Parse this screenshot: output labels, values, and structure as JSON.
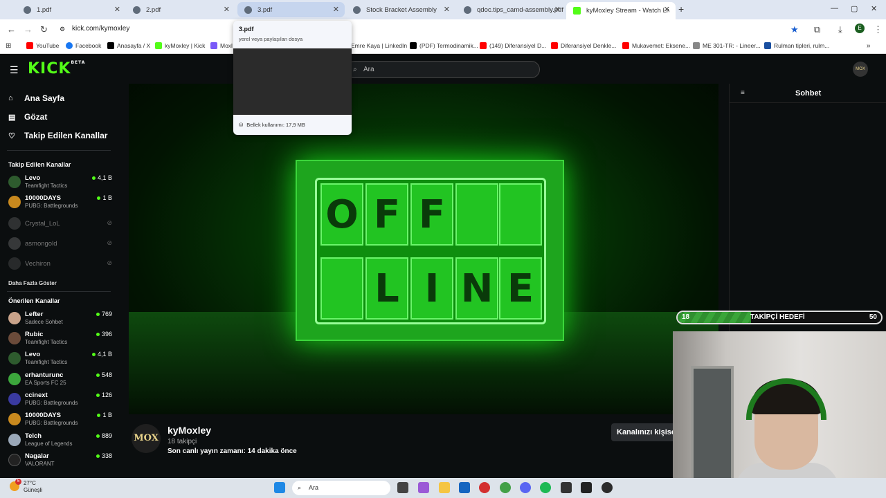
{
  "browser": {
    "tabs": [
      {
        "label": "1.pdf",
        "color": "#5f6b7a"
      },
      {
        "label": "2.pdf",
        "color": "#5f6b7a"
      },
      {
        "label": "3.pdf",
        "color": "#5f6b7a"
      },
      {
        "label": "Stock Bracket Assembly",
        "color": "#5f6b7a"
      },
      {
        "label": "qdoc.tips_camd-assembly.pdf",
        "color": "#5f6b7a"
      },
      {
        "label": "kyMoxley Stream - Watch Live o",
        "color": "#53fc18"
      }
    ],
    "url": "kick.com/kymoxley",
    "bookmarks": [
      {
        "label": "YouTube",
        "color": "#ff0000"
      },
      {
        "label": "Facebook",
        "color": "#1877f2"
      },
      {
        "label": "Anasayfa / X",
        "color": "#000000"
      },
      {
        "label": "kyMoxley | Kick",
        "color": "#53fc18"
      },
      {
        "label": "Moxl",
        "color": "#7a5af8"
      },
      {
        "label": "Emre Kaya | LinkedIn",
        "color": "#ffffff"
      },
      {
        "label": "(PDF) Termodinamik...",
        "color": "#000000"
      },
      {
        "label": "(149) Diferansiyel D...",
        "color": "#ff0000"
      },
      {
        "label": "Diferansiyel Denkle...",
        "color": "#ff0000"
      },
      {
        "label": "Mukavemet: Eksene...",
        "color": "#ff0000"
      },
      {
        "label": "ME 301-TR: - Lineer...",
        "color": "#888888"
      },
      {
        "label": "Rulman tipleri, rulm...",
        "color": "#1a4fa0"
      }
    ]
  },
  "hovercard": {
    "title": "3.pdf",
    "subtitle": "yerel veya paylaşılan dosya",
    "memory": "Bellek kullanımı: 17,9 MB"
  },
  "kick": {
    "logo": "KICK",
    "logo_beta": "BETA",
    "search_placeholder": "Ara",
    "nav": {
      "home": "Ana Sayfa",
      "browse": "Gözat",
      "following": "Takip Edilen Kanallar"
    },
    "followed_title": "Takip Edilen Kanallar",
    "followed": [
      {
        "name": "Levo",
        "game": "Teamfight Tactics",
        "viewers": "4,1 B",
        "live": true,
        "color": "#2e5b2e"
      },
      {
        "name": "10000DAYS",
        "game": "PUBG: Battlegrounds",
        "viewers": "1 B",
        "live": true,
        "color": "#c8891e"
      },
      {
        "name": "Crystal_LoL",
        "game": "",
        "viewers": "",
        "live": false,
        "color": "#666"
      },
      {
        "name": "asmongold",
        "game": "",
        "viewers": "",
        "live": false,
        "color": "#777"
      },
      {
        "name": "Vechiron",
        "game": "",
        "viewers": "",
        "live": false,
        "color": "#555"
      }
    ],
    "show_more": "Daha Fazla Göster",
    "recommended_title": "Önerilen Kanallar",
    "recommended": [
      {
        "name": "Lefter",
        "game": "Sadece Sohbet",
        "viewers": "769",
        "color": "#c9a38a"
      },
      {
        "name": "Rubic",
        "game": "Teamfight Tactics",
        "viewers": "396",
        "color": "#6b4b3a"
      },
      {
        "name": "Levo",
        "game": "Teamfight Tactics",
        "viewers": "4,1 B",
        "color": "#2e5b2e"
      },
      {
        "name": "erhanturunc",
        "game": "EA Sports FC 25",
        "viewers": "548",
        "color": "#3ca63c"
      },
      {
        "name": "ccinext",
        "game": "PUBG: Battlegrounds",
        "viewers": "126",
        "color": "#3a3aa0"
      },
      {
        "name": "10000DAYS",
        "game": "PUBG: Battlegrounds",
        "viewers": "1 B",
        "color": "#c8891e"
      },
      {
        "name": "Telch",
        "game": "League of Legends",
        "viewers": "889",
        "color": "#9aa8b8"
      },
      {
        "name": "Nagalar",
        "game": "VALORANT",
        "viewers": "338",
        "color": "#222"
      }
    ],
    "offline_top": [
      "O",
      "F",
      "F",
      "",
      ""
    ],
    "offline_bottom": [
      "",
      "L",
      "I",
      "N",
      "E"
    ],
    "channel": {
      "avatar_text": "MOX",
      "name": "kyMoxley",
      "followers": "18 takipçi",
      "last_live": "Son canlı yayın zamanı: 14 dakika önce",
      "customize": "Kanalınızı kişiselleştirin"
    },
    "chat_title": "Sohbet"
  },
  "goal": {
    "current": "18",
    "label": "TAKİPÇİ HEDEFİ",
    "target": "50",
    "progress": 0.36
  },
  "taskbar": {
    "temp": "27°C",
    "weather": "Güneşli",
    "badge": "5",
    "search": "Ara",
    "icons": [
      {
        "name": "windows-icon",
        "color": "#1e88e5"
      },
      {
        "name": "taskview-icon",
        "color": "#444"
      },
      {
        "name": "copilot-icon",
        "color": "#9b59d6"
      },
      {
        "name": "explorer-icon",
        "color": "#f5c542"
      },
      {
        "name": "store-icon",
        "color": "#1565c0"
      },
      {
        "name": "opera-icon",
        "color": "#d32f2f"
      },
      {
        "name": "chrome-icon",
        "color": "#43a047"
      },
      {
        "name": "discord-icon",
        "color": "#5865f2"
      },
      {
        "name": "spotify-icon",
        "color": "#1db954"
      },
      {
        "name": "terminal-icon",
        "color": "#333"
      },
      {
        "name": "app-icon",
        "color": "#222"
      },
      {
        "name": "obs-icon",
        "color": "#2b2b2b"
      }
    ]
  }
}
